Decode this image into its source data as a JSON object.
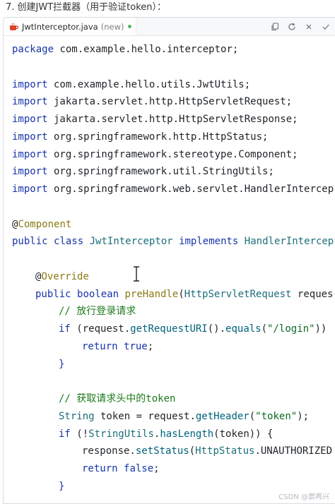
{
  "page_heading": "7. 创建JWT拦截器（用于验证token）：",
  "tab": {
    "filename": "JwtInterceptor.java",
    "status": "(new)",
    "icon": "java-file-icon"
  },
  "tab_actions": [
    "copy-icon",
    "refresh-icon",
    "close-icon",
    "check-icon"
  ],
  "code": {
    "l1": [
      "package",
      " com.example.hello.interceptor;"
    ],
    "l3": [
      "import",
      " com.example.hello.utils.JwtUtils;"
    ],
    "l4": [
      "import",
      " jakarta.servlet.http.HttpServletRequest;"
    ],
    "l5": [
      "import",
      " jakarta.servlet.http.HttpServletResponse;"
    ],
    "l6": [
      "import",
      " org.springframework.http.HttpStatus;"
    ],
    "l7": [
      "import",
      " org.springframework.stereotype.Component;"
    ],
    "l8": [
      "import",
      " org.springframework.util.StringUtils;"
    ],
    "l9": [
      "import",
      " org.springframework.web.servlet.HandlerIntercep"
    ],
    "l11": [
      "@",
      "Component"
    ],
    "l12": [
      "public",
      " ",
      "class",
      " ",
      "JwtInterceptor",
      " ",
      "implements",
      " ",
      "HandlerIntercep"
    ],
    "l14": [
      "@",
      "Override"
    ],
    "l15": [
      "public",
      " ",
      "boolean",
      " ",
      "preHandle",
      "(",
      "HttpServletRequest",
      " reques"
    ],
    "l16": "// 放行登录请求",
    "l17": [
      "if",
      " (request.",
      "getRequestURI",
      "().",
      "equals",
      "(",
      "\"/login\"",
      "))"
    ],
    "l18": [
      "return",
      " ",
      "true",
      ";"
    ],
    "l19": "}",
    "l21": "// 获取请求头中的token",
    "l22": [
      "String",
      " token = request.",
      "getHeader",
      "(",
      "\"token\"",
      ");"
    ],
    "l23": [
      "if",
      " (!",
      "StringUtils",
      ".",
      "hasLength",
      "(token)) {"
    ],
    "l24": [
      "response.",
      "setStatus",
      "(",
      "HttpStatus",
      ".UNAUTHORIZED"
    ],
    "l25": [
      "return",
      " ",
      "false",
      ";"
    ],
    "l26": "}"
  },
  "watermark": "CSDN @窦再兴",
  "colors": {
    "keyword": "#1735a9",
    "annotation": "#8a7a14",
    "comment": "#1b7a1b",
    "string": "#0b6b25",
    "tab_dot": "#57b36b"
  }
}
